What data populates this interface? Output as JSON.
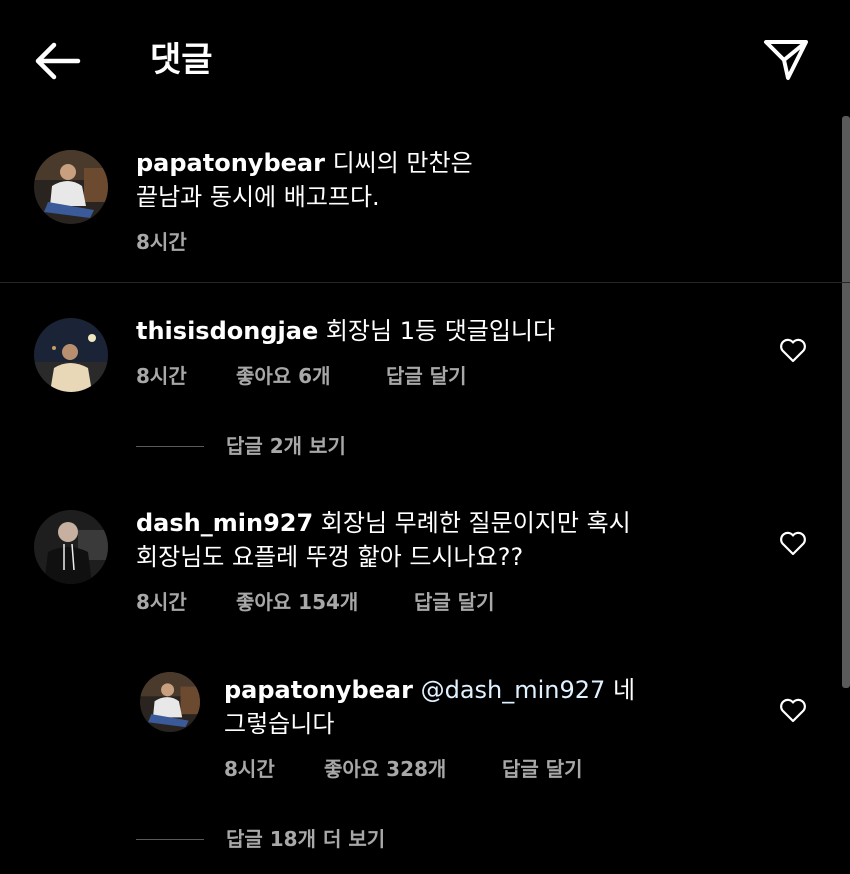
{
  "header": {
    "title": "댓글"
  },
  "caption": {
    "username": "papatonybear",
    "text": " 디씨의 만찬은",
    "text2": "끝남과 동시에 배고프다.",
    "time": "8시간"
  },
  "comments": [
    {
      "username": "thisisdongjae",
      "line1": " 회장님 1등 댓글입니다",
      "time": "8시간",
      "likes": "좋아요 6개",
      "reply": "답글 달기",
      "view_replies": "답글 2개 보기"
    },
    {
      "username": "dash_min927",
      "line1": " 회장님 무례한 질문이지만 혹시",
      "line2": "회장님도 요플레 뚜껑 핥아 드시나요??",
      "time": "8시간",
      "likes": "좋아요 154개",
      "reply": "답글 달기"
    }
  ],
  "reply": {
    "username": "papatonybear",
    "mention": "@dash_min927",
    "line1": " 네",
    "line2": "그렇습니다",
    "time": "8시간",
    "likes": "좋아요 328개",
    "reply": "답글 달기",
    "more_replies": "답글 18개 더 보기"
  },
  "colors": {
    "background": "#000000",
    "text": "#ffffff",
    "secondary": "#a8a8a8",
    "mention": "#e0f1ff"
  },
  "icons": [
    "back-arrow-icon",
    "send-icon",
    "heart-icon"
  ]
}
